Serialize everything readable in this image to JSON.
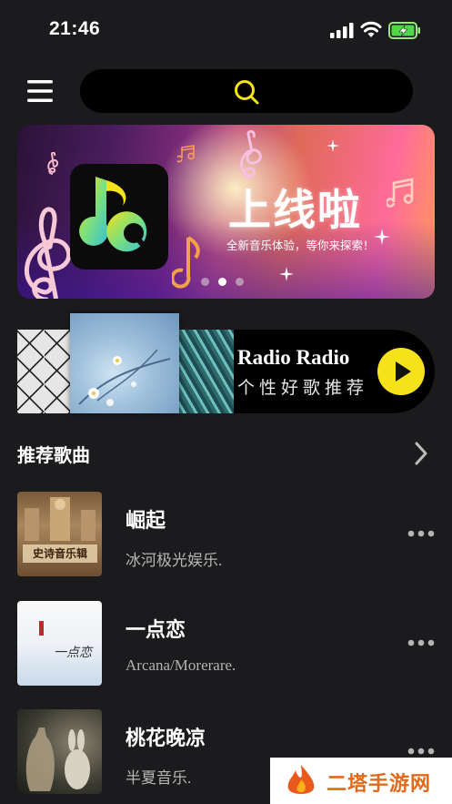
{
  "status_bar": {
    "time": "21:46"
  },
  "search": {
    "icon": "search-icon"
  },
  "banner": {
    "headline": "上线啦",
    "subtitle": "全新音乐体验，等你来探索！",
    "pagination": {
      "count": 3,
      "active": 1
    }
  },
  "radio": {
    "title": "Radio Radio",
    "subtitle": "个性好歌推荐",
    "play_icon": "play-icon"
  },
  "recommended": {
    "title": "推荐歌曲",
    "songs": [
      {
        "title": "崛起",
        "artist": "冰河极光娱乐.",
        "cover_caption": "史诗音乐辑"
      },
      {
        "title": "一点恋",
        "artist": "Arcana/Morerare.",
        "cover_caption": "一点恋"
      },
      {
        "title": "桃花晚凉",
        "artist": "半夏音乐."
      }
    ]
  },
  "watermark": {
    "text": "二塔手游网"
  },
  "colors": {
    "accent": "#f6e21a",
    "background": "#1b1b1d",
    "watermark": "#e06a1a"
  }
}
